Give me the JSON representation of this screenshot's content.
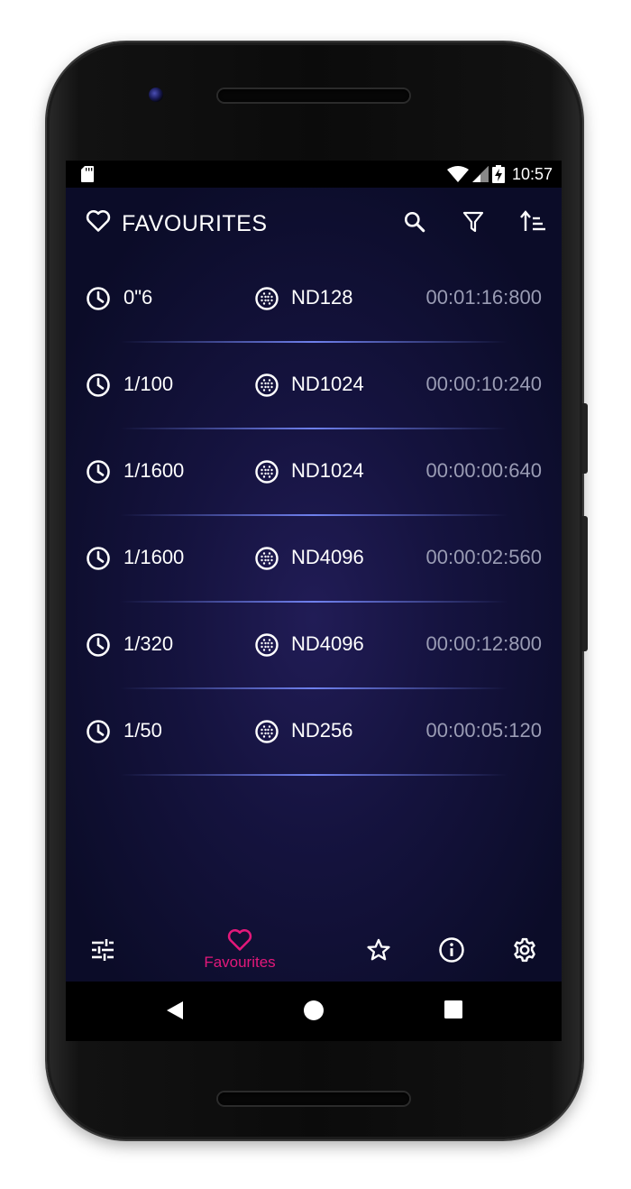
{
  "status_bar": {
    "time": "10:57"
  },
  "app_bar": {
    "title": "FAVOURITES",
    "icons": [
      "heart-icon",
      "search-icon",
      "filter-icon",
      "sort-icon"
    ]
  },
  "favourites": [
    {
      "shutter": "0\"6",
      "filter": "ND128",
      "duration": "00:01:16:800"
    },
    {
      "shutter": "1/100",
      "filter": "ND1024",
      "duration": "00:00:10:240"
    },
    {
      "shutter": "1/1600",
      "filter": "ND1024",
      "duration": "00:00:00:640"
    },
    {
      "shutter": "1/1600",
      "filter": "ND4096",
      "duration": "00:00:02:560"
    },
    {
      "shutter": "1/320",
      "filter": "ND4096",
      "duration": "00:00:12:800"
    },
    {
      "shutter": "1/50",
      "filter": "ND256",
      "duration": "00:00:05:120"
    }
  ],
  "bottom_nav": {
    "items": [
      {
        "icon": "sliders-icon",
        "label": ""
      },
      {
        "icon": "heart-icon",
        "label": "Favourites",
        "active": true
      },
      {
        "icon": "star-icon",
        "label": ""
      },
      {
        "icon": "info-icon",
        "label": ""
      },
      {
        "icon": "gear-icon",
        "label": ""
      }
    ]
  },
  "colors": {
    "background": "#15133f",
    "accent": "#e3187a",
    "text": "#ffffff",
    "muted_text": "#9a9cb4",
    "divider": "#7886ff"
  }
}
